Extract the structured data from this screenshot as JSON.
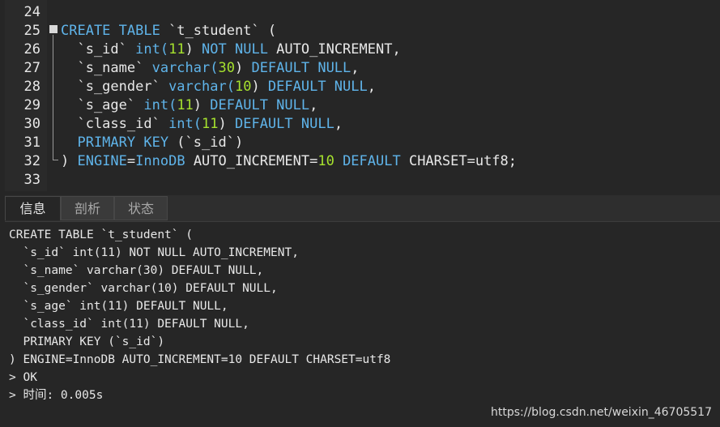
{
  "editor": {
    "lines": [
      {
        "n": "24",
        "tokens": []
      },
      {
        "n": "25",
        "tokens": [
          [
            "CREATE TABLE ",
            "kw"
          ],
          [
            "`t_student` (",
            "txt"
          ]
        ]
      },
      {
        "n": "26",
        "tokens": [
          [
            "  `s_id` ",
            "txt"
          ],
          [
            "int(",
            "kw"
          ],
          [
            "11",
            "num"
          ],
          [
            ") ",
            "txt"
          ],
          [
            "NOT NULL ",
            "kw"
          ],
          [
            "AUTO_INCREMENT,",
            "txt"
          ]
        ]
      },
      {
        "n": "27",
        "tokens": [
          [
            "  `s_name` ",
            "txt"
          ],
          [
            "varchar(",
            "kw"
          ],
          [
            "30",
            "num"
          ],
          [
            ") ",
            "txt"
          ],
          [
            "DEFAULT NULL",
            "kw"
          ],
          [
            ",",
            "txt"
          ]
        ]
      },
      {
        "n": "28",
        "tokens": [
          [
            "  `s_gender` ",
            "txt"
          ],
          [
            "varchar(",
            "kw"
          ],
          [
            "10",
            "num"
          ],
          [
            ") ",
            "txt"
          ],
          [
            "DEFAULT NULL",
            "kw"
          ],
          [
            ",",
            "txt"
          ]
        ]
      },
      {
        "n": "29",
        "tokens": [
          [
            "  `s_age` ",
            "txt"
          ],
          [
            "int(",
            "kw"
          ],
          [
            "11",
            "num"
          ],
          [
            ") ",
            "txt"
          ],
          [
            "DEFAULT NULL",
            "kw"
          ],
          [
            ",",
            "txt"
          ]
        ]
      },
      {
        "n": "30",
        "tokens": [
          [
            "  `class_id` ",
            "txt"
          ],
          [
            "int(",
            "kw"
          ],
          [
            "11",
            "num"
          ],
          [
            ") ",
            "txt"
          ],
          [
            "DEFAULT NULL",
            "kw"
          ],
          [
            ",",
            "txt"
          ]
        ]
      },
      {
        "n": "31",
        "tokens": [
          [
            "  PRIMARY KEY ",
            "kw"
          ],
          [
            "(`s_id`)",
            "txt"
          ]
        ]
      },
      {
        "n": "32",
        "tokens": [
          [
            ") ",
            "txt"
          ],
          [
            "ENGINE",
            "kw"
          ],
          [
            "=",
            "txt"
          ],
          [
            "InnoDB ",
            "kw"
          ],
          [
            "AUTO_INCREMENT=",
            "txt"
          ],
          [
            "10 ",
            "num"
          ],
          [
            "DEFAULT ",
            "kw"
          ],
          [
            "CHARSET=utf8;",
            "txt"
          ]
        ]
      },
      {
        "n": "33",
        "tokens": []
      }
    ]
  },
  "tabs": [
    {
      "label": "信息",
      "active": true
    },
    {
      "label": "剖析"
    },
    {
      "label": "状态"
    }
  ],
  "output": {
    "lines": [
      "CREATE TABLE `t_student` (",
      "  `s_id` int(11) NOT NULL AUTO_INCREMENT,",
      "  `s_name` varchar(30) DEFAULT NULL,",
      "  `s_gender` varchar(10) DEFAULT NULL,",
      "  `s_age` int(11) DEFAULT NULL,",
      "  `class_id` int(11) DEFAULT NULL,",
      "  PRIMARY KEY (`s_id`)",
      ") ENGINE=InnoDB AUTO_INCREMENT=10 DEFAULT CHARSET=utf8",
      "> OK",
      "> 时间: 0.005s"
    ]
  },
  "watermark": "https://blog.csdn.net/weixin_46705517",
  "colors": {
    "keyword": "#5fb4ea",
    "number": "#a6e22e",
    "text": "#e8e8e8",
    "background": "#262626"
  }
}
